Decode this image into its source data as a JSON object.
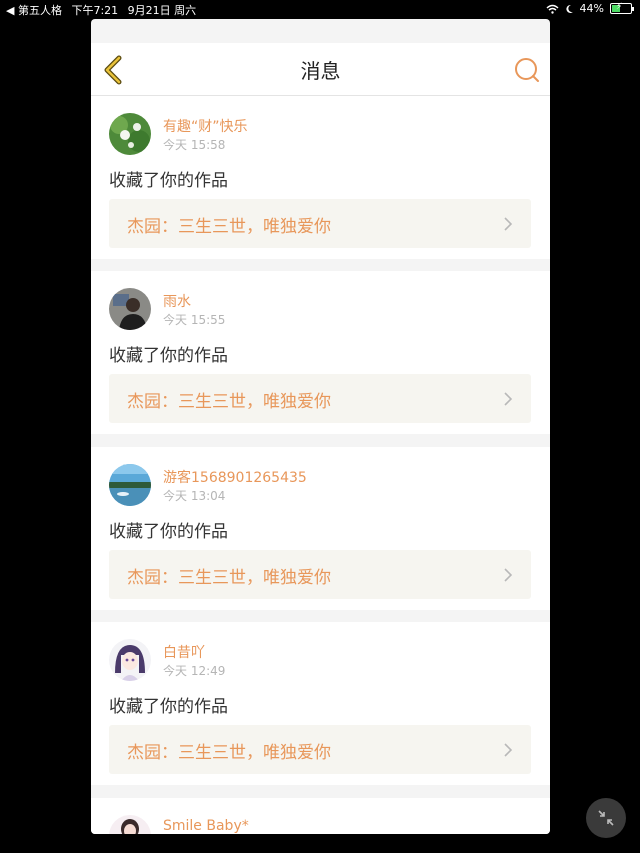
{
  "status_bar": {
    "back_app": "◀ 第五人格",
    "time": "下午7:21",
    "date": "9月21日 周六",
    "battery": "44%",
    "battery_level": 0.44
  },
  "header": {
    "title": "消息"
  },
  "messages": [
    {
      "username": "有趣“财”快乐",
      "time": "今天 15:58",
      "action": "收藏了你的作品",
      "work_title": "杰园：三生三世，唯独爱你"
    },
    {
      "username": "雨水",
      "time": "今天 15:55",
      "action": "收藏了你的作品",
      "work_title": "杰园：三生三世，唯独爱你"
    },
    {
      "username": "游客1568901265435",
      "time": "今天 13:04",
      "action": "收藏了你的作品",
      "work_title": "杰园：三生三世，唯独爱你"
    },
    {
      "username": "白昔吖",
      "time": "今天 12:49",
      "action": "收藏了你的作品",
      "work_title": "杰园：三生三世，唯独爱你"
    },
    {
      "username": "Smile Baby*"
    }
  ],
  "colors": {
    "accent": "#e8975a",
    "back_icon": "#c9a227",
    "work_box_bg": "#f6f5f0"
  }
}
